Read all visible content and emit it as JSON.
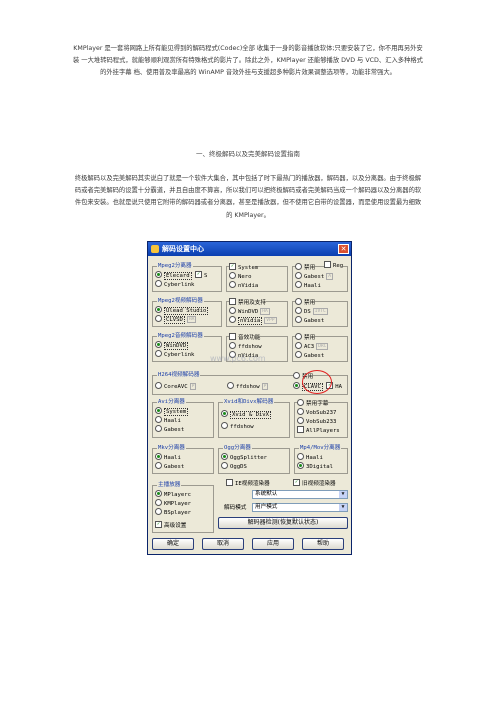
{
  "intro": "KMPlayer 是一套将网路上所有能见得到的解码程式(Codec)全部 收集于一身的影音播放软体;只要安装了它，你不用再另外安装 一大堆转码程式，就能够顺利观赏所有特殊格式的影片了。除此之外，KMPlayer 还能够播放 DVD 与 VCD、汇入多种格式的外挂字幕 档、使用普及率最高的 WinAMP 音效外挂与支援超多种影片效果调整选项等，功能非常强大。",
  "heading": "一、终极解码以及完美解码设置指南",
  "body": "终极解码以及完美解码其实说白了就是一个软件大集合，其中包括了时下最热门的播放器，解码器，以及分离器。由于终极解码或者完美解码的设置十分霸道，并且自由度不算高，所以我们可以把终极解码或者完美解码当成一个解码器以及分离器的软件包来安装。也就是说只使用它附带的解码器或者分离器，甚至是播放器，但不使用它自带的设置器，而是使用设置最为细致的 KMPlayer。",
  "dialog": {
    "title": "解码设置中心",
    "close_icon": "close-icon",
    "reg": "Reg",
    "groups": {
      "mpeg2_splitter": {
        "title": "Mpeg2分离器",
        "opt1": "Elecard",
        "chk": "S",
        "opt2": "Cyberlink"
      },
      "system": {
        "chk": "System",
        "opt1": "Nero",
        "opt2": "nVidia"
      },
      "disable1": {
        "opt0": "禁用",
        "opt1": "Gabest",
        "tag1": "A",
        "opt2": "Haali"
      },
      "mpeg2_video": {
        "title": "Mpeg2视频解码器",
        "opt1": "Ulead Studio",
        "opt2": "CLVSD",
        "tag2": "HA"
      },
      "disable_pro": {
        "chk": "禁用及支持",
        "opt1": "WinDVD",
        "tag1": "HA",
        "opt2": "nVidia",
        "tag2": "VPP"
      },
      "disable2": {
        "opt0": "禁用",
        "opt1": "DS",
        "tag1": "IVTC",
        "opt2": "Gabest"
      },
      "mpeg2_audio": {
        "title": "Mpeg2音频解码器",
        "opt1": "WinDVD",
        "opt2": "Cyberlink"
      },
      "audio_feat": {
        "chk": "音效功能",
        "opt1": "ffdshow",
        "opt2": "nVidia"
      },
      "disable3": {
        "opt0": "禁用",
        "opt1": "AC3",
        "tag1": "DRC",
        "opt2": "Gabest"
      },
      "h264": {
        "title": "H264视频解码器",
        "opt1": "CoreAVC",
        "tag1": "P",
        "opt2": "ffdshow",
        "tag2": "P",
        "opt0": "禁用",
        "opt3": "CLAVC",
        "chk": "HA"
      },
      "avi_splitter": {
        "title": "Avi分离器",
        "opt1": "System",
        "opt2": "Haali",
        "opt3": "Gabest"
      },
      "xvid_divx": {
        "title": "Xvid和Divx解码器",
        "opt1": "Xvid & DivX",
        "opt2": "ffdshow"
      },
      "subtitle": {
        "opt0": "禁用字幕",
        "opt1": "VobSub237",
        "opt2": "VobSub233",
        "chk": "AllPlayers"
      },
      "mkv_splitter": {
        "title": "Mkv分离器",
        "opt1": "Haali",
        "opt2": "Gabest"
      },
      "ogg_splitter": {
        "title": "Ogg分离器",
        "opt1": "OggSplitter",
        "opt2": "OggDS"
      },
      "mp4": {
        "title": "Mp4/Mov分离器",
        "opt1": "Haali",
        "opt2": "3Digital"
      },
      "player": {
        "title": "主播放器",
        "opt1": "MPlayerc",
        "opt2": "KMPlayer",
        "opt3": "BSplayer",
        "chk": "高级设置"
      }
    },
    "renderer_chk": "IE视频渲染器",
    "decode_chk": "旧视频渲染器",
    "renderer_select": "系统默认",
    "mode_label": "解码模式",
    "mode_select": "用户模式",
    "wide_button": "解码器检测(恢复默认状态)",
    "buttons": {
      "ok": "确定",
      "cancel": "取消",
      "apply": "应用",
      "help": "帮助"
    },
    "watermark": "www.pc6.com"
  }
}
